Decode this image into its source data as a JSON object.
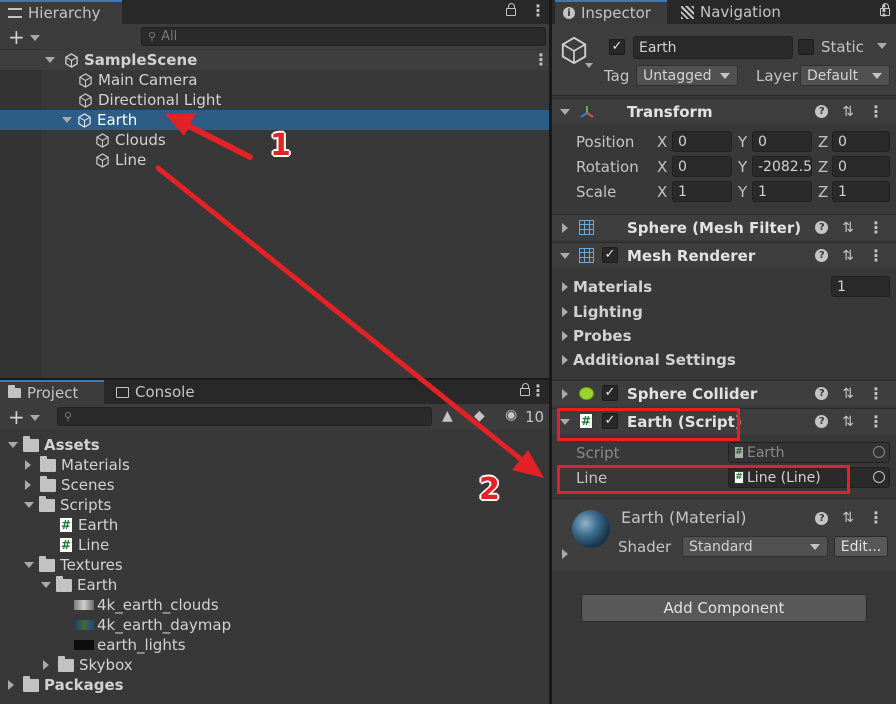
{
  "hierarchy": {
    "tab_label": "Hierarchy",
    "search_placeholder": "All",
    "scene_name": "SampleScene",
    "items": [
      {
        "label": "Main Camera"
      },
      {
        "label": "Directional Light"
      },
      {
        "label": "Earth"
      },
      {
        "label": "Clouds"
      },
      {
        "label": "Line"
      }
    ]
  },
  "project": {
    "tabs": [
      {
        "label": "Project"
      },
      {
        "label": "Console"
      }
    ],
    "hidden_count": "10",
    "tree": [
      {
        "label": "Assets"
      },
      {
        "label": "Materials"
      },
      {
        "label": "Scenes"
      },
      {
        "label": "Scripts"
      },
      {
        "label": "Earth"
      },
      {
        "label": "Line"
      },
      {
        "label": "Textures"
      },
      {
        "label": "Earth"
      },
      {
        "label": "4k_earth_clouds"
      },
      {
        "label": "4k_earth_daymap"
      },
      {
        "label": "earth_lights"
      },
      {
        "label": "Skybox"
      },
      {
        "label": "Packages"
      }
    ]
  },
  "inspector": {
    "tabs": [
      {
        "label": "Inspector"
      },
      {
        "label": "Navigation"
      }
    ],
    "object_name": "Earth",
    "static_label": "Static",
    "tag_label": "Tag",
    "tag_value": "Untagged",
    "layer_label": "Layer",
    "layer_value": "Default",
    "transform": {
      "title": "Transform",
      "rows": [
        {
          "label": "Position",
          "x": "0",
          "y": "0",
          "z": "0"
        },
        {
          "label": "Rotation",
          "x": "0",
          "y": "-2082.5",
          "z": "0"
        },
        {
          "label": "Scale",
          "x": "1",
          "y": "1",
          "z": "1"
        }
      ],
      "axis_x": "X",
      "axis_y": "Y",
      "axis_z": "Z"
    },
    "mesh_filter_title": "Sphere (Mesh Filter)",
    "mesh_renderer": {
      "title": "Mesh Renderer",
      "materials_label": "Materials",
      "materials_count": "1",
      "lighting_label": "Lighting",
      "probes_label": "Probes",
      "additional_label": "Additional Settings"
    },
    "sphere_collider_title": "Sphere Collider",
    "earth_script": {
      "title": "Earth (Script)",
      "script_label": "Script",
      "script_value": "Earth",
      "line_label": "Line",
      "line_value": "Line (Line)"
    },
    "material": {
      "name": "Earth (Material)",
      "shader_label": "Shader",
      "shader_value": "Standard",
      "edit_label": "Edit..."
    },
    "add_component_label": "Add Component"
  },
  "annotations": {
    "marker_1": "1",
    "marker_2": "2",
    "color": "#e32227"
  }
}
